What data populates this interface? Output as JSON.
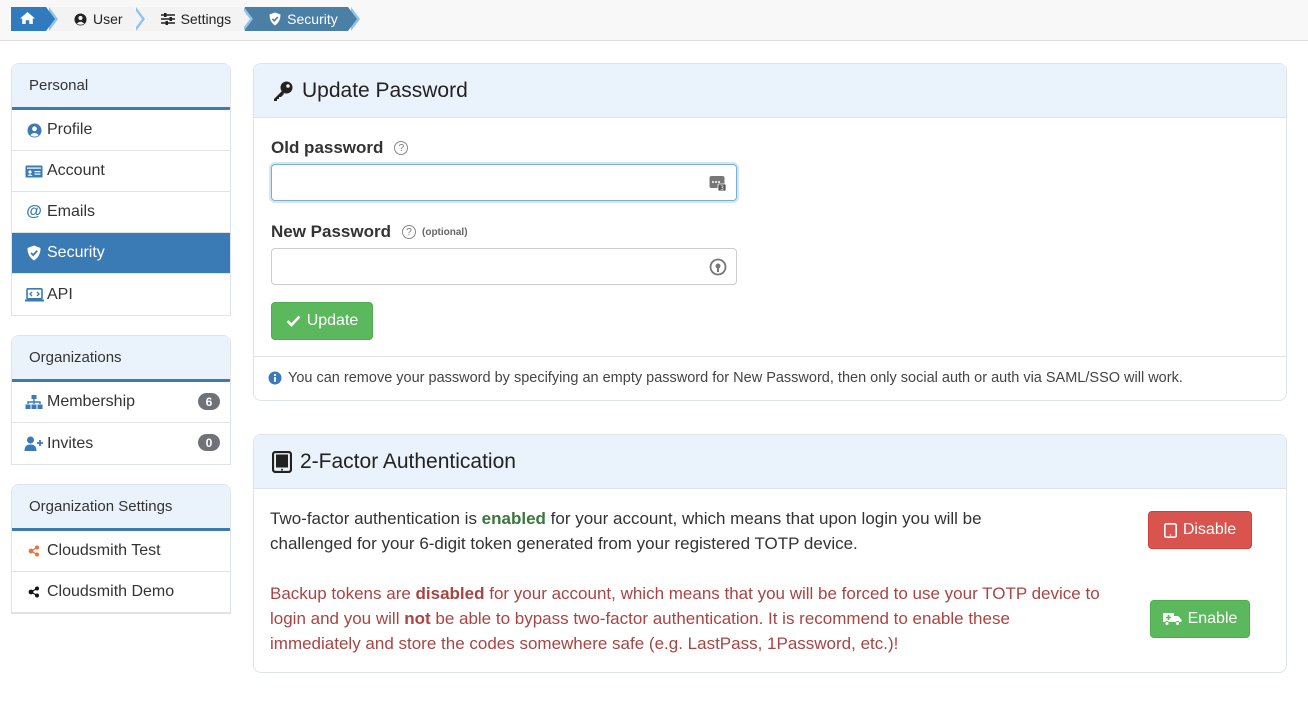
{
  "breadcrumb": {
    "items": [
      {
        "label": "",
        "icon": "home-icon"
      },
      {
        "label": "User",
        "icon": "user-circle-icon"
      },
      {
        "label": "Settings",
        "icon": "sliders-icon"
      },
      {
        "label": "Security",
        "icon": "shield-icon"
      }
    ],
    "active": "Security"
  },
  "sidebar": {
    "personal": {
      "title": "Personal",
      "items": [
        {
          "label": "Profile",
          "icon": "user-circle-icon"
        },
        {
          "label": "Account",
          "icon": "id-card-icon"
        },
        {
          "label": "Emails",
          "icon": "at-icon"
        },
        {
          "label": "Security",
          "icon": "shield-icon"
        },
        {
          "label": "API",
          "icon": "laptop-code-icon"
        }
      ],
      "active": "Security"
    },
    "organizations": {
      "title": "Organizations",
      "items": [
        {
          "label": "Membership",
          "icon": "sitemap-icon",
          "count": "6"
        },
        {
          "label": "Invites",
          "icon": "user-plus-icon",
          "count": "0"
        }
      ]
    },
    "org_settings": {
      "title": "Organization Settings",
      "items": [
        {
          "label": "Cloudsmith Test",
          "icon": "cloudsmith-orange-icon"
        },
        {
          "label": "Cloudsmith Demo",
          "icon": "cloudsmith-black-icon"
        }
      ]
    }
  },
  "password_panel": {
    "title": "Update Password",
    "old_password": {
      "label": "Old password",
      "help": "?",
      "value": ""
    },
    "new_password": {
      "label": "New Password",
      "help": "?",
      "optional": "(optional)",
      "value": ""
    },
    "update_button": "Update",
    "info": "You can remove your password by specifying an empty password for New Password, then only social auth or auth via SAML/SSO will work."
  },
  "twofa_panel": {
    "title": "2-Factor Authentication",
    "status_pre": "Two-factor authentication is ",
    "status_word": "enabled",
    "status_post": " for your account, which means that upon login you will be challenged for your 6-digit token generated from your registered TOTP device.",
    "disable_button": "Disable",
    "backup_pre": "Backup tokens are ",
    "backup_word": "disabled",
    "backup_mid": " for your account, which means that you will be forced to use your TOTP device to login and you will ",
    "backup_not": "not",
    "backup_post": " be able to bypass two-factor authentication. It is recommend to enable these immediately and store the codes somewhere safe (e.g. LastPass, 1Password, etc.)!",
    "enable_button": "Enable"
  },
  "colors": {
    "primary": "#3a7ab5",
    "success": "#5cb85c",
    "danger": "#d9534f",
    "warning_text": "#a94442",
    "panel_header_bg": "#eaf3fb"
  }
}
